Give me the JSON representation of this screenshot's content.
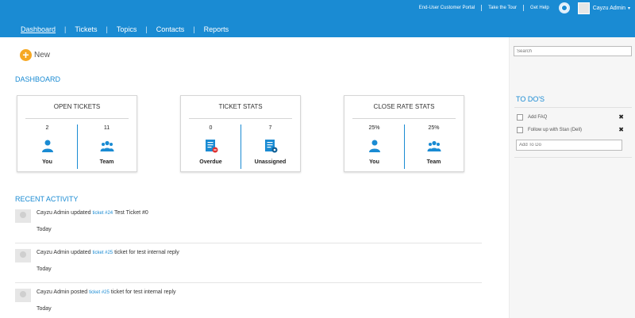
{
  "header": {
    "links": [
      "End-User Customer Portal",
      "Take the Tour",
      "Get Help"
    ],
    "user_name": "Cayzu Admin",
    "caret": "▾"
  },
  "nav": {
    "items": [
      "Dashboard",
      "Tickets",
      "Topics",
      "Contacts",
      "Reports"
    ],
    "separator": "|",
    "active": "Dashboard"
  },
  "new_button": {
    "icon": "+",
    "label": "New"
  },
  "dashboard": {
    "title": "DASHBOARD",
    "cards": [
      {
        "title": "OPEN TICKETS",
        "left": {
          "value": "2",
          "label": "You",
          "icon": "user-icon"
        },
        "right": {
          "value": "11",
          "label": "Team",
          "icon": "team-icon"
        }
      },
      {
        "title": "TICKET STATS",
        "left": {
          "value": "0",
          "label": "Overdue",
          "icon": "overdue-ticket-icon"
        },
        "right": {
          "value": "7",
          "label": "Unassigned",
          "icon": "unassigned-ticket-icon"
        }
      },
      {
        "title": "CLOSE RATE STATS",
        "left": {
          "value": "25%",
          "label": "You",
          "icon": "user-icon"
        },
        "right": {
          "value": "25%",
          "label": "Team",
          "icon": "team-icon"
        }
      }
    ]
  },
  "recent_activity": {
    "title": "RECENT ACTIVITY",
    "items": [
      {
        "actor": "Cayzu Admin updated",
        "link": "ticket #24",
        "subject": "Test Ticket #0",
        "date": "Today"
      },
      {
        "actor": "Cayzu Admin updated",
        "link": "ticket #25",
        "subject": "ticket for test internal reply",
        "date": "Today"
      },
      {
        "actor": "Cayzu Admin posted",
        "link": "ticket #25",
        "subject": "ticket for test internal reply",
        "date": "Today"
      }
    ]
  },
  "sidebar": {
    "search_placeholder": "Search",
    "todo_title": "TO DO'S",
    "todos": [
      {
        "label": "Add FAQ",
        "remove": "✖"
      },
      {
        "label": "Follow up with Stan (Dell)",
        "remove": "✖"
      }
    ],
    "add_todo_placeholder": "Add To Do"
  },
  "colors": {
    "brand": "#1a8bd3",
    "accent": "#f6a823",
    "ticket_icon": "#1a8bd3",
    "overdue_badge": "#e03131"
  }
}
